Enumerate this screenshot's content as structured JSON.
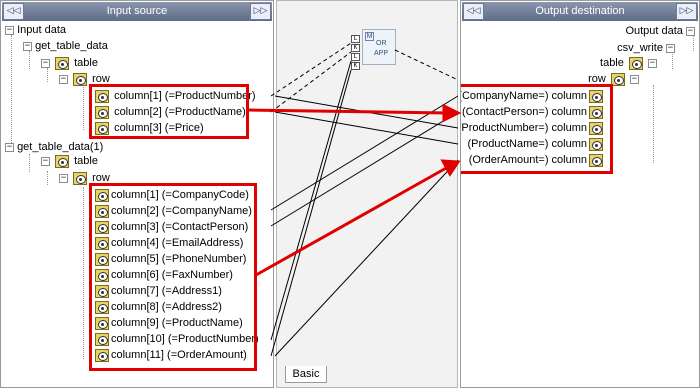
{
  "left_panel": {
    "title": "Input source",
    "collapse_glyph": "◁◁",
    "expand_glyph": "▷▷",
    "tree": {
      "root": "Input data",
      "source1": "get_table_data",
      "source1_table": "table",
      "source1_row": "row",
      "source1_columns": [
        "column[1] (=ProductNumber)",
        "column[2] (=ProductName)",
        "column[3] (=Price)"
      ],
      "source2": "get_table_data(1)",
      "source2_table": "table",
      "source2_row": "row",
      "source2_columns": [
        "column[1] (=CompanyCode)",
        "column[2] (=CompanyName)",
        "column[3] (=ContactPerson)",
        "column[4] (=EmailAddress)",
        "column[5] (=PhoneNumber)",
        "column[6] (=FaxNumber)",
        "column[7] (=Address1)",
        "column[8] (=Address2)",
        "column[9] (=ProductName)",
        "column[10] (=ProductNumber)",
        "column[11] (=OrderAmount)"
      ]
    }
  },
  "center_panel": {
    "function_icon_letter": "M",
    "function_text_line1": "OR",
    "function_text_line2": "APP",
    "pin_labels": [
      "L",
      "K",
      "L",
      "K"
    ],
    "tab_label": "Basic"
  },
  "right_panel": {
    "title": "Output destination",
    "collapse_glyph": "◁◁",
    "expand_glyph": "▷▷",
    "tree": {
      "root": "Output data",
      "target": "csv_write",
      "target_table": "table",
      "target_row": "row",
      "target_columns": [
        "(CompanyName=) column",
        "(ContactPerson=) column",
        "(ProductNumber=) column",
        "(ProductName=) column",
        "(OrderAmount=) column"
      ]
    }
  },
  "colors": {
    "highlight": "#e00000",
    "header": "#6b779a"
  }
}
